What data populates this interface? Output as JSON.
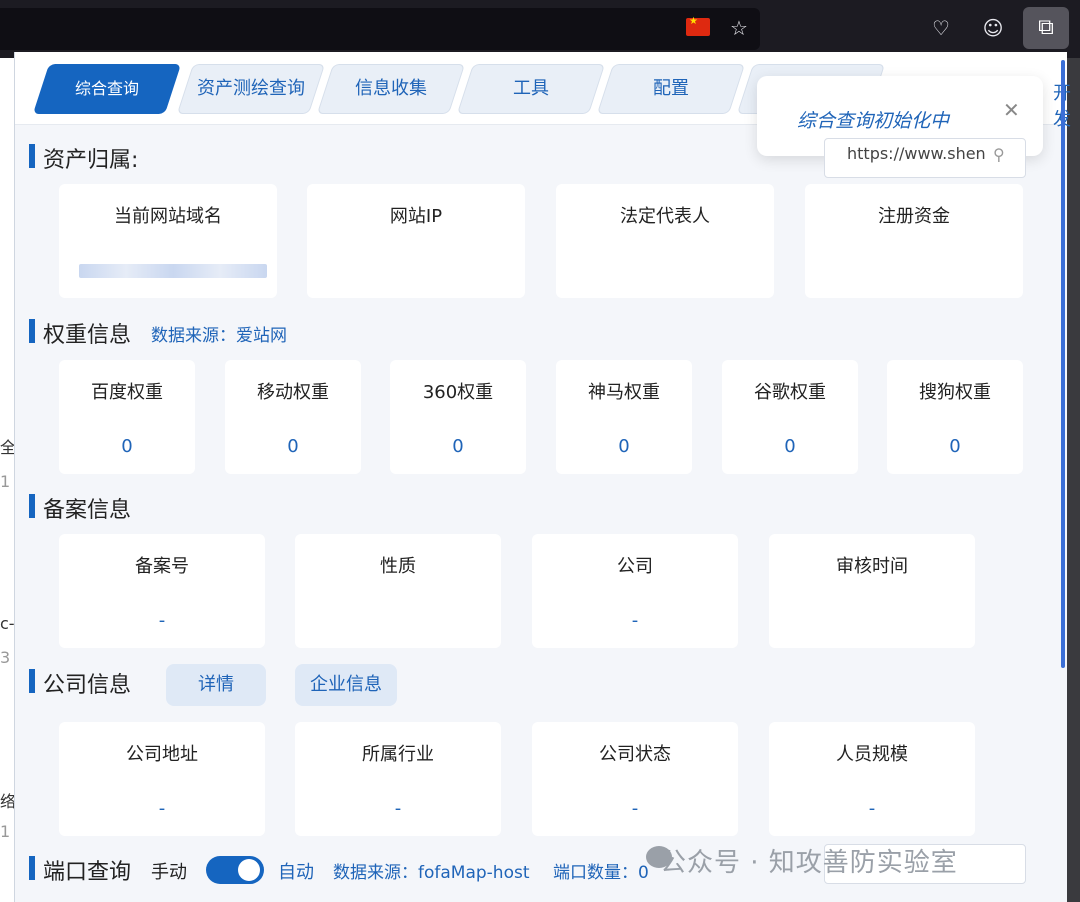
{
  "browser": {
    "star_icon": "☆",
    "pocket_icon": "♡",
    "account_icon": "☺",
    "extensions_icon": "⧉"
  },
  "left_fragments": [
    "全",
    "1",
    "c-",
    "3",
    "络",
    "1"
  ],
  "tabs": [
    {
      "label": "综合查询"
    },
    {
      "label": "资产测绘查询"
    },
    {
      "label": "信息收集"
    },
    {
      "label": "工具"
    },
    {
      "label": "配置"
    },
    {
      "label": ""
    }
  ],
  "tab_cut_text": "开发",
  "toast": {
    "message": "综合查询初始化中",
    "close": "✕"
  },
  "search": {
    "value": "https://www.shen"
  },
  "asset": {
    "title": "资产归属:",
    "cards": [
      {
        "label": "当前网站域名",
        "value": ""
      },
      {
        "label": "网站IP",
        "value": ""
      },
      {
        "label": "法定代表人",
        "value": ""
      },
      {
        "label": "注册资金",
        "value": ""
      }
    ]
  },
  "weight": {
    "title": "权重信息",
    "source": "数据来源：爱站网",
    "cards": [
      {
        "label": "百度权重",
        "value": "0"
      },
      {
        "label": "移动权重",
        "value": "0"
      },
      {
        "label": "360权重",
        "value": "0"
      },
      {
        "label": "神马权重",
        "value": "0"
      },
      {
        "label": "谷歌权重",
        "value": "0"
      },
      {
        "label": "搜狗权重",
        "value": "0"
      }
    ]
  },
  "icp": {
    "title": "备案信息",
    "cards": [
      {
        "label": "备案号",
        "value": "-"
      },
      {
        "label": "性质",
        "value": ""
      },
      {
        "label": "公司",
        "value": "-"
      },
      {
        "label": "审核时间",
        "value": ""
      }
    ]
  },
  "company": {
    "title": "公司信息",
    "detail_btn": "详情",
    "enterprise_btn": "企业信息",
    "cards": [
      {
        "label": "公司地址",
        "value": "-"
      },
      {
        "label": "所属行业",
        "value": "-"
      },
      {
        "label": "公司状态",
        "value": "-"
      },
      {
        "label": "人员规模",
        "value": "-"
      }
    ]
  },
  "port": {
    "title": "端口查询",
    "manual": "手动",
    "auto": "自动",
    "source": "数据来源：fofaMap-host",
    "count": "端口数量：0"
  },
  "watermark": "公众号 · 知攻善防实验室",
  "colors": {
    "accent": "#1565c0",
    "link": "#1f64b8",
    "panel_bg": "#f4f6fa"
  }
}
